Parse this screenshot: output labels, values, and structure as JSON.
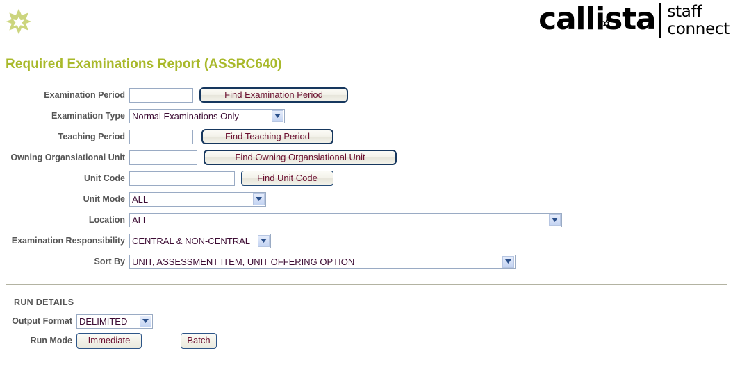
{
  "branding": {
    "star_icon": "eight-point-star-icon",
    "logo_main": "callista",
    "logo_sub_line1": "staff",
    "logo_sub_line2": "connect",
    "logo_star_icon": "small-six-point-star-icon",
    "title_color": "#a9b92b"
  },
  "page": {
    "title": "Required Examinations Report (ASSRC640)"
  },
  "form": {
    "fields": [
      {
        "key": "examination_period",
        "label": "Examination Period",
        "type": "text",
        "value": "",
        "placeholder": "",
        "button": "Find Examination Period"
      },
      {
        "key": "examination_type",
        "label": "Examination Type",
        "type": "select",
        "value": "Normal Examinations Only",
        "options": [
          "Normal Examinations Only"
        ]
      },
      {
        "key": "teaching_period",
        "label": "Teaching Period",
        "type": "text",
        "value": "",
        "placeholder": "",
        "button": "Find Teaching Period"
      },
      {
        "key": "owning_organisational_unit",
        "label": "Owning Organsiational Unit",
        "type": "text",
        "value": "",
        "placeholder": "",
        "button": "Find Owning Organsiational Unit"
      },
      {
        "key": "unit_code",
        "label": "Unit Code",
        "type": "text",
        "value": "",
        "placeholder": "",
        "button": "Find Unit Code"
      },
      {
        "key": "unit_mode",
        "label": "Unit Mode",
        "type": "select",
        "value": "ALL",
        "options": [
          "ALL"
        ]
      },
      {
        "key": "location",
        "label": "Location",
        "type": "select",
        "value": "ALL",
        "options": [
          "ALL"
        ]
      },
      {
        "key": "examination_responsibility",
        "label": "Examination Responsibility",
        "type": "select",
        "value": "CENTRAL & NON-CENTRAL",
        "options": [
          "CENTRAL & NON-CENTRAL"
        ]
      },
      {
        "key": "sort_by",
        "label": "Sort By",
        "type": "select",
        "value": "UNIT, ASSESSMENT ITEM, UNIT OFFERING OPTION",
        "options": [
          "UNIT, ASSESSMENT ITEM, UNIT OFFERING OPTION"
        ]
      }
    ]
  },
  "run_details": {
    "heading": "RUN DETAILS",
    "output_format_label": "Output Format",
    "output_format_value": "DELIMITED",
    "output_format_options": [
      "DELIMITED"
    ],
    "run_mode_label": "Run Mode",
    "immediate_button": "Immediate",
    "batch_button": "Batch"
  },
  "colors": {
    "accent": "#a9b92b",
    "label": "#555555",
    "field_text": "#3c0b33",
    "button_text": "#6b1030",
    "button_border": "#16375e",
    "input_border": "#9aabc4",
    "divider": "#b3b3a2"
  }
}
